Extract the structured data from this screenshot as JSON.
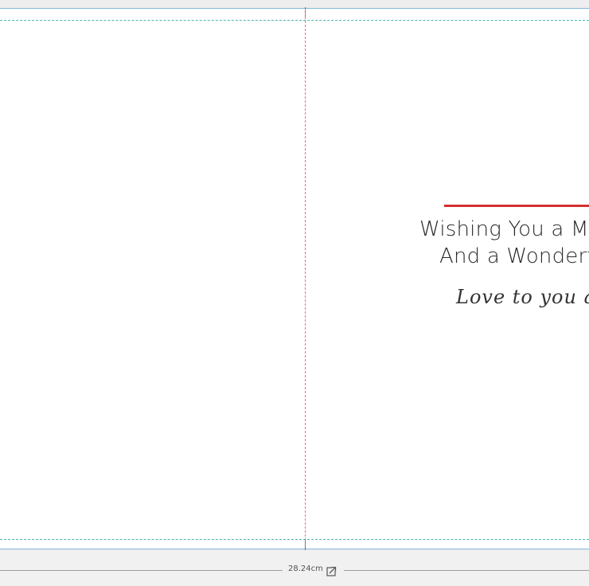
{
  "card": {
    "inside_right": {
      "greeting_line_1": "Wishing You a Me",
      "greeting_line_2": "And a Wonderf",
      "signature": "Love to you and"
    }
  },
  "ruler": {
    "width_label": "28.24cm",
    "resize_icon": "resize-icon"
  },
  "colors": {
    "accent_rule": "#d32f2f",
    "fold_guide": "#e57373",
    "bleed_guide": "#4db6ac",
    "sheet_border": "#7fb8d8"
  }
}
